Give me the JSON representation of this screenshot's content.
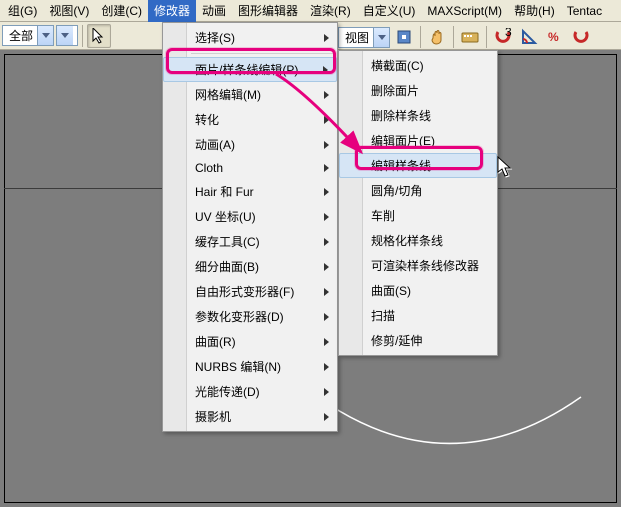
{
  "menubar": {
    "items": [
      {
        "label": "组(G)"
      },
      {
        "label": "视图(V)"
      },
      {
        "label": "创建(C)"
      },
      {
        "label": "修改器"
      },
      {
        "label": "动画"
      },
      {
        "label": "图形编辑器"
      },
      {
        "label": "渲染(R)"
      },
      {
        "label": "自定义(U)"
      },
      {
        "label": "MAXScript(M)"
      },
      {
        "label": "帮助(H)"
      },
      {
        "label": "Tentac"
      }
    ],
    "open_index": 3
  },
  "toolbar": {
    "combo_all": "全部",
    "combo_view": "视图"
  },
  "modifier_menu": {
    "items": [
      {
        "label": "选择(S)",
        "sep_after": true
      },
      {
        "label": "面片/样条线编辑(P)",
        "hover": true
      },
      {
        "label": "网格编辑(M)"
      },
      {
        "label": "转化"
      },
      {
        "label": "动画(A)"
      },
      {
        "label": "Cloth"
      },
      {
        "label": "Hair 和 Fur"
      },
      {
        "label": "UV 坐标(U)"
      },
      {
        "label": "缓存工具(C)"
      },
      {
        "label": "细分曲面(B)"
      },
      {
        "label": "自由形式变形器(F)"
      },
      {
        "label": "参数化变形器(D)"
      },
      {
        "label": "曲面(R)"
      },
      {
        "label": "NURBS 编辑(N)"
      },
      {
        "label": "光能传递(D)"
      },
      {
        "label": "摄影机"
      }
    ]
  },
  "submenu": {
    "items": [
      {
        "label": "横截面(C)"
      },
      {
        "label": "删除面片"
      },
      {
        "label": "删除样条线"
      },
      {
        "label": "编辑面片(E)"
      },
      {
        "label": "编辑样条线",
        "hover": true
      },
      {
        "label": "圆角/切角"
      },
      {
        "label": "车削"
      },
      {
        "label": "规格化样条线"
      },
      {
        "label": "可渲染样条线修改器"
      },
      {
        "label": "曲面(S)"
      },
      {
        "label": "扫描"
      },
      {
        "label": "修剪/延伸"
      }
    ]
  },
  "colors": {
    "highlight": "#e6007e"
  }
}
